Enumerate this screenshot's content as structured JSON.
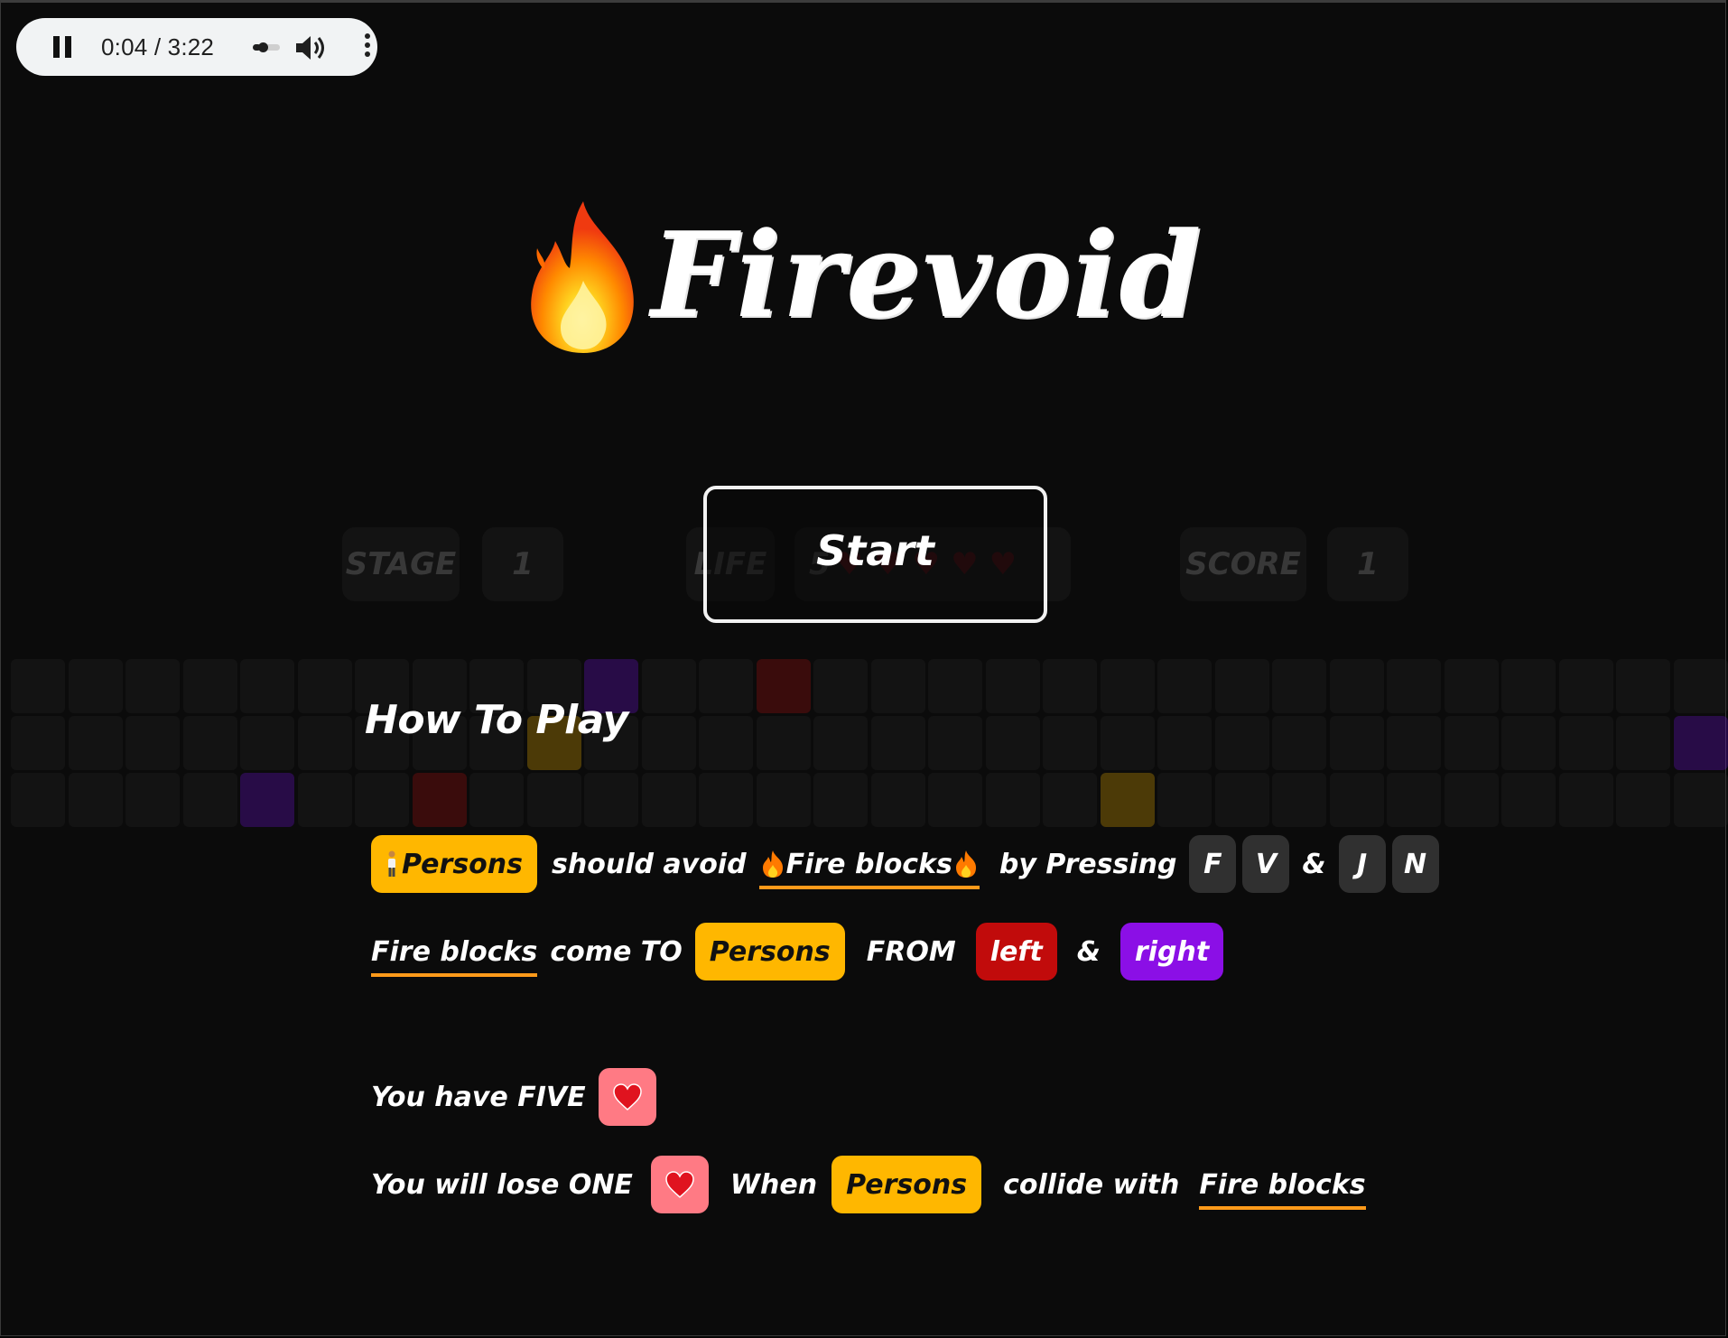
{
  "player": {
    "time": "0:04 / 3:22",
    "progress": 0.3
  },
  "title": "Firevoid",
  "start_label": "Start",
  "stats": {
    "stage_label": "STAGE",
    "stage_value": "1",
    "life_label": "LIFE",
    "life_value": "5",
    "score_label": "SCORE",
    "score_value": "1"
  },
  "howto": {
    "heading": "How To Play",
    "row1": {
      "persons": "Persons",
      "should_avoid": "should avoid",
      "fire_blocks": "Fire blocks",
      "by_pressing": "by Pressing",
      "key_f": "F",
      "key_v": "V",
      "amp": "&",
      "key_j": "J",
      "key_n": "N"
    },
    "row2": {
      "fire_blocks": "Fire blocks",
      "come_to": "come TO",
      "persons": "Persons",
      "from": "FROM",
      "left": "left",
      "amp": "&",
      "right": "right"
    },
    "row3": {
      "you_have_five": "You have FIVE"
    },
    "row4": {
      "you_will_lose_one": "You will lose ONE",
      "when": "When",
      "persons": "Persons",
      "collide_with": "collide with",
      "fire_blocks": "Fire blocks"
    }
  },
  "colors": {
    "background": "#0b0b0b",
    "persons_pill": "#ffb700",
    "left_pill": "#c10b0b",
    "right_pill": "#8b0fe6",
    "heart_pill": "#ff7a84",
    "underline": "#ff9a1a"
  },
  "icons": [
    "pause-icon",
    "volume-icon",
    "more-options-icon",
    "fire-icon",
    "person-icon",
    "heart-icon"
  ]
}
